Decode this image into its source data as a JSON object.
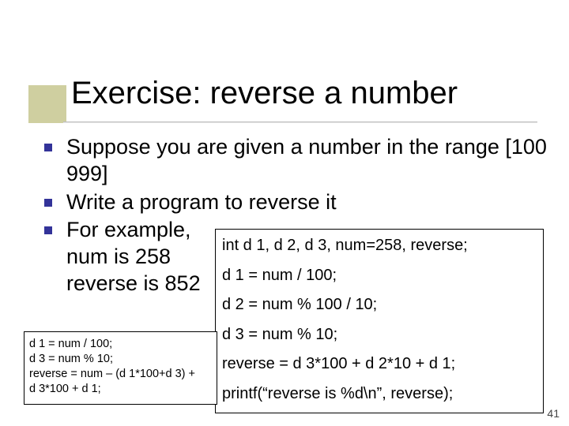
{
  "title": "Exercise: reverse a number",
  "bullets": {
    "b1": "Suppose you are given a number in the range [100 999]",
    "b2": "Write a program to reverse it",
    "b3a": "For example,",
    "b3b": "num is 258",
    "b3c": "reverse is 852"
  },
  "right_code": {
    "l1": "int d 1, d 2, d 3, num=258, reverse;",
    "l2": "d 1 = num / 100;",
    "l3": "d 2 = num % 100 / 10;",
    "l4": "d 3 = num % 10;",
    "l5": "reverse = d 3*100 + d 2*10 + d 1;",
    "l6": "printf(“reverse is %d\\n”, reverse);"
  },
  "left_code": {
    "l1": "d 1 = num / 100;",
    "l2": "d 3 = num % 10;",
    "l3": "reverse = num – (d 1*100+d 3) +",
    "l4": "               d 3*100 + d 1;"
  },
  "slide_number": "41"
}
